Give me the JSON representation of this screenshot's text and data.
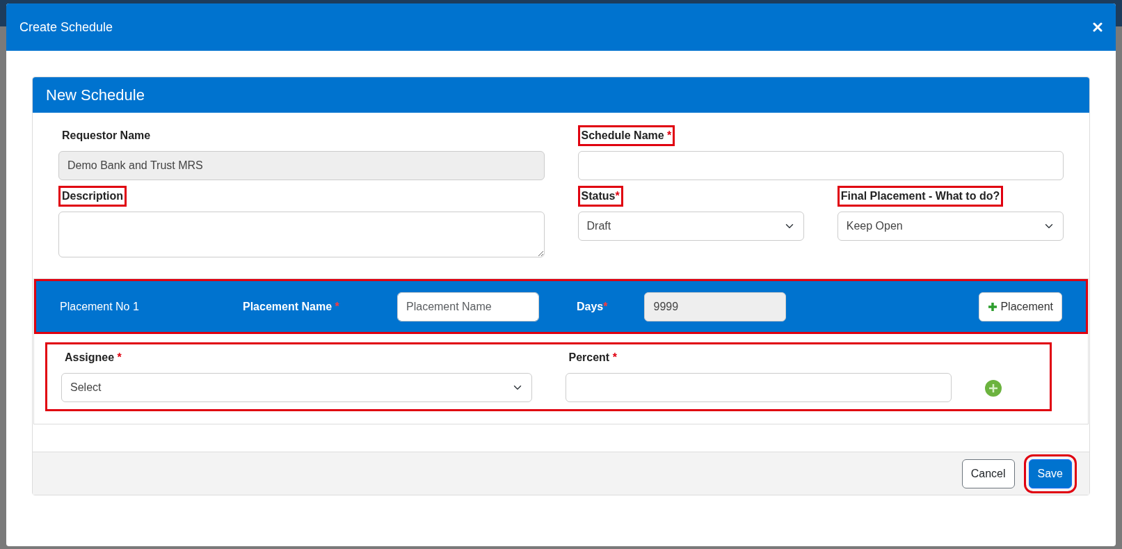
{
  "dialog": {
    "title": "Create Schedule"
  },
  "card": {
    "title": "New Schedule"
  },
  "form_rows": [
    [
      {
        "kind": "text",
        "label": "Requestor Name",
        "value": "Demo Bank and Trust MRS",
        "disabled": true,
        "highlighted": false
      },
      {
        "kind": "text",
        "label": "Schedule Name",
        "mark": " *",
        "highlighted": true
      }
    ],
    [
      {
        "kind": "textarea",
        "label": "Description",
        "highlighted": true
      },
      {
        "kind": "select",
        "label": "Status",
        "mark": "*",
        "value": "Draft",
        "highlighted": true
      },
      {
        "kind": "select",
        "label": "Final Placement - What to do?",
        "value": "Keep Open",
        "highlighted": true
      }
    ]
  ],
  "placement": {
    "highlighted": true,
    "number_label": "Placement No 1",
    "name_label": "Placement Name",
    "name_mark": " *",
    "name_placeholder": "Placement Name",
    "days_label": "Days",
    "days_mark": "*",
    "days_value": "9999",
    "days_disabled": true,
    "add_button": "Placement"
  },
  "assignees": {
    "highlighted": true,
    "assignee_label": "Assignee",
    "assignee_mark": " *",
    "assignee_value": "Select",
    "percent_label": "Percent",
    "percent_mark": " *"
  },
  "footer": {
    "buttons": [
      {
        "label": "Cancel",
        "kind": "secondary",
        "highlighted": false
      },
      {
        "label": "Save",
        "kind": "primary",
        "highlighted": true
      }
    ]
  }
}
